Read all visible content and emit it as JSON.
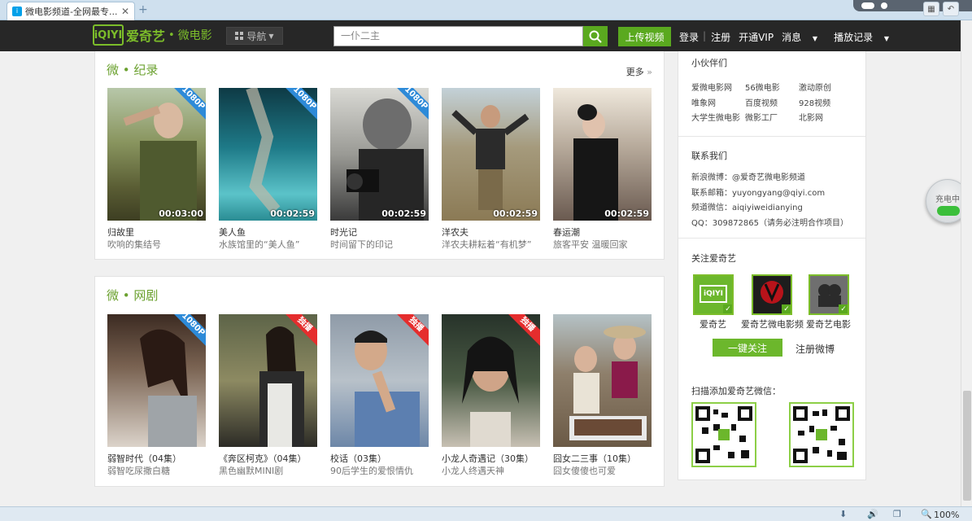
{
  "browser": {
    "tab_title": "微电影频道-全网最专...",
    "tab_close": "✕",
    "new_tab": "+",
    "zoom": "100%"
  },
  "header": {
    "logo_mark": "iQIYI",
    "logo_name": "爱奇艺",
    "logo_dot": "•",
    "channel": "微电影",
    "nav_label": "导航",
    "search_placeholder": "一仆二主",
    "upload_label": "上传视频",
    "login": "登录",
    "register": "注册",
    "vip": "开通VIP",
    "messages": "消息",
    "history": "播放记录"
  },
  "sections": [
    {
      "title": "微 • 纪录",
      "more": "更多",
      "items": [
        {
          "title": "归故里",
          "desc": "吹响的集结号",
          "duration": "00:03:00",
          "badge": "1080P"
        },
        {
          "title": "美人鱼",
          "desc": "水族馆里的“美人鱼”",
          "duration": "00:02:59",
          "badge": "1080P"
        },
        {
          "title": "时光记",
          "desc": "时间留下的印记",
          "duration": "00:02:59",
          "badge": "1080P"
        },
        {
          "title": "洋农夫",
          "desc": "洋农夫耕耘着“有机梦”",
          "duration": "00:02:59",
          "badge": ""
        },
        {
          "title": "春运潮",
          "desc": "旅客平安 温暖回家",
          "duration": "00:02:59",
          "badge": ""
        }
      ]
    },
    {
      "title": "微 • 网剧",
      "items": [
        {
          "title": "弱智时代（04集）",
          "desc": "弱智吃尿撒白糖",
          "badge": "1080P"
        },
        {
          "title": "《奔区柯克》（04集）",
          "desc": "黑色幽默MINI剧",
          "badge": "独播"
        },
        {
          "title": "校话（03集）",
          "desc": "90后学生的爱恨情仇",
          "badge": "独播"
        },
        {
          "title": "小龙人奇遇记（30集）",
          "desc": "小龙人终遇天神",
          "badge": "独播"
        },
        {
          "title": "囧女二三事（10集）",
          "desc": "囧女傻傻也可爱",
          "badge": ""
        }
      ]
    }
  ],
  "sidebar": {
    "partners_title": "小伙伴们",
    "partners": [
      "爱微电影网",
      "56微电影",
      "激动原创",
      "唯象网",
      "百度视频",
      "928视频",
      "大学生微电影",
      "微影工厂",
      "北影网"
    ],
    "contact_title": "联系我们",
    "contacts": [
      "新浪微博：@爱奇艺微电影频道",
      "联系邮箱：yuyongyang@qiyi.com",
      "频道微信：aiqiyiweidianying",
      "QQ：309872865（请务必注明合作项目）"
    ],
    "follow_title": "关注爱奇艺",
    "follow_accounts": [
      "爱奇艺",
      "爱奇艺微电影频",
      "爱奇艺电影"
    ],
    "follow_all": "一键关注",
    "register_weibo": "注册微博",
    "wechat_title": "扫描添加爱奇艺微信："
  },
  "widget": {
    "charge_label": "充电中"
  },
  "colors": {
    "brand_green": "#7cbd2a",
    "button_green": "#5aa91f",
    "header_bg": "#272727",
    "hd_blue": "#2d8ad8",
    "exclusive_red": "#e52d2d"
  }
}
